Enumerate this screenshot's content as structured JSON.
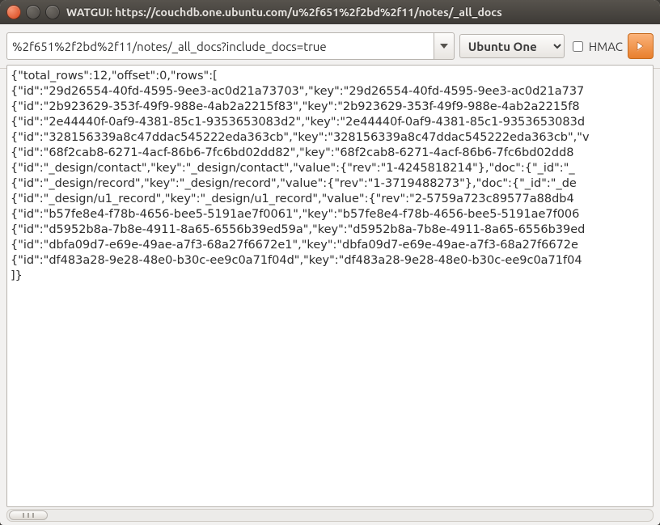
{
  "window": {
    "title": "WATGUI: https://couchdb.one.ubuntu.com/u%2f651%2f2bd%2f11/notes/_all_docs"
  },
  "toolbar": {
    "url_value": "%2f651%2f2bd%2f11/notes/_all_docs?include_docs=true",
    "provider_selected": "Ubuntu One",
    "hmac_label": "HMAC",
    "hmac_checked": false
  },
  "response": {
    "lines": [
      "{\"total_rows\":12,\"offset\":0,\"rows\":[",
      "{\"id\":\"29d26554-40fd-4595-9ee3-ac0d21a73703\",\"key\":\"29d26554-40fd-4595-9ee3-ac0d21a737",
      "{\"id\":\"2b923629-353f-49f9-988e-4ab2a2215f83\",\"key\":\"2b923629-353f-49f9-988e-4ab2a2215f8",
      "{\"id\":\"2e44440f-0af9-4381-85c1-9353653083d2\",\"key\":\"2e44440f-0af9-4381-85c1-9353653083d",
      "{\"id\":\"328156339a8c47ddac545222eda363cb\",\"key\":\"328156339a8c47ddac545222eda363cb\",\"v",
      "{\"id\":\"68f2cab8-6271-4acf-86b6-7fc6bd02dd82\",\"key\":\"68f2cab8-6271-4acf-86b6-7fc6bd02dd8",
      "{\"id\":\"_design/contact\",\"key\":\"_design/contact\",\"value\":{\"rev\":\"1-4245818214\"},\"doc\":{\"_id\":\"_",
      "{\"id\":\"_design/record\",\"key\":\"_design/record\",\"value\":{\"rev\":\"1-3719488273\"},\"doc\":{\"_id\":\"_de",
      "{\"id\":\"_design/u1_record\",\"key\":\"_design/u1_record\",\"value\":{\"rev\":\"2-5759a723c89577a88db4",
      "{\"id\":\"b57fe8e4-f78b-4656-bee5-5191ae7f0061\",\"key\":\"b57fe8e4-f78b-4656-bee5-5191ae7f006",
      "{\"id\":\"d5952b8a-7b8e-4911-8a65-6556b39ed59a\",\"key\":\"d5952b8a-7b8e-4911-8a65-6556b39ed",
      "{\"id\":\"dbfa09d7-e69e-49ae-a7f3-68a27f6672e1\",\"key\":\"dbfa09d7-e69e-49ae-a7f3-68a27f6672e",
      "{\"id\":\"df483a28-9e28-48e0-b30c-ee9c0a71f04d\",\"key\":\"df483a28-9e28-48e0-b30c-ee9c0a71f04",
      "]}"
    ]
  }
}
